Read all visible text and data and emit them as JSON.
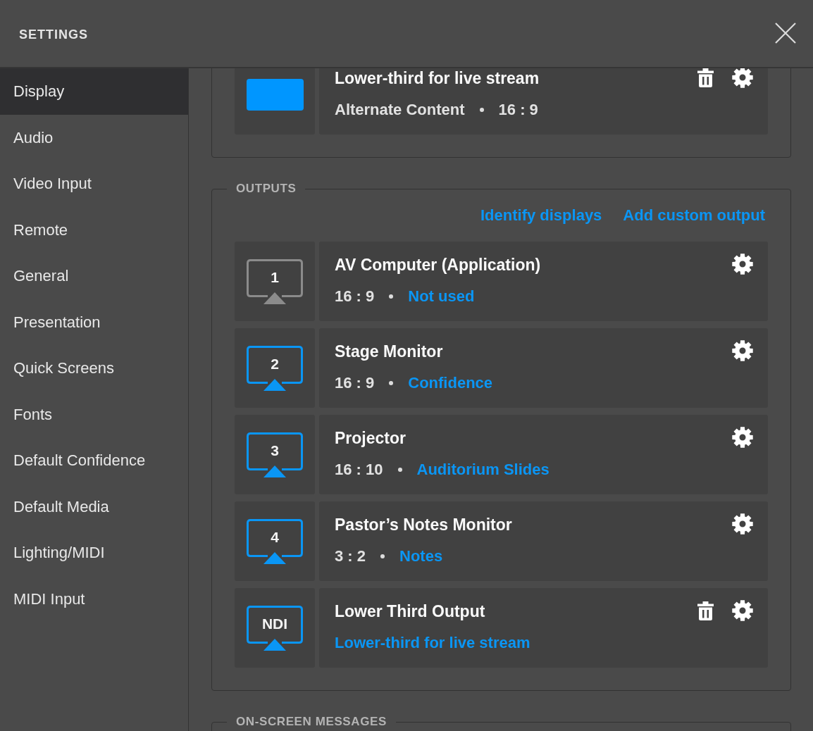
{
  "window": {
    "title": "SETTINGS"
  },
  "sidebar": {
    "items": [
      {
        "label": "Display",
        "selected": true
      },
      {
        "label": "Audio",
        "selected": false
      },
      {
        "label": "Video Input",
        "selected": false
      },
      {
        "label": "Remote",
        "selected": false
      },
      {
        "label": "General",
        "selected": false
      },
      {
        "label": "Presentation",
        "selected": false
      },
      {
        "label": "Quick Screens",
        "selected": false
      },
      {
        "label": "Fonts",
        "selected": false
      },
      {
        "label": "Default Confidence",
        "selected": false
      },
      {
        "label": "Default Media",
        "selected": false
      },
      {
        "label": "Lighting/MIDI",
        "selected": false
      },
      {
        "label": "MIDI Input",
        "selected": false
      }
    ]
  },
  "sections": [
    {
      "rows": [
        {
          "kind": "layer",
          "title": "Lower-third for live stream",
          "deletable": true,
          "details": [
            {
              "kind": "plain",
              "text": "Alternate Content"
            },
            {
              "kind": "plain",
              "text": "16 : 9"
            }
          ]
        }
      ]
    },
    {
      "legend": "OUTPUTS",
      "links": [
        "Identify displays",
        "Add custom output"
      ],
      "rows": [
        {
          "kind": "output",
          "badge": "1",
          "active": false,
          "title": "AV Computer (Application)",
          "deletable": false,
          "details": [
            {
              "kind": "plain",
              "text": "16 : 9"
            },
            {
              "kind": "link",
              "text": "Not used"
            }
          ]
        },
        {
          "kind": "output",
          "badge": "2",
          "active": true,
          "title": "Stage Monitor",
          "deletable": false,
          "details": [
            {
              "kind": "plain",
              "text": "16 : 9"
            },
            {
              "kind": "link",
              "text": "Confidence"
            }
          ]
        },
        {
          "kind": "output",
          "badge": "3",
          "active": true,
          "title": "Projector",
          "deletable": false,
          "details": [
            {
              "kind": "plain",
              "text": "16 : 10"
            },
            {
              "kind": "link",
              "text": "Auditorium Slides"
            }
          ]
        },
        {
          "kind": "output",
          "badge": "4",
          "active": true,
          "title": "Pastor’s Notes Monitor",
          "deletable": false,
          "details": [
            {
              "kind": "plain",
              "text": "3 : 2"
            },
            {
              "kind": "link",
              "text": "Notes"
            }
          ]
        },
        {
          "kind": "output",
          "badge": "NDI",
          "active": true,
          "title": "Lower Third Output",
          "deletable": true,
          "details": [
            {
              "kind": "link",
              "text": "Lower-third for live stream"
            }
          ]
        }
      ]
    },
    {
      "legend": "ON-SCREEN MESSAGES"
    }
  ]
}
